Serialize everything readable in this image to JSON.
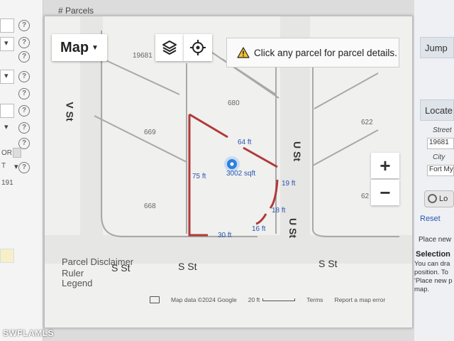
{
  "left_panel": {
    "top_label": "# Parcels",
    "texts": [
      "OR",
      "T",
      "191"
    ]
  },
  "map": {
    "type_button": "Map",
    "notice": "Click any parcel for parcel details.",
    "parcel_numbers": [
      "19681",
      "680",
      "669",
      "668",
      "622",
      "62"
    ],
    "measurements": [
      "64 ft",
      "75 ft",
      "3002 sqft",
      "19 ft",
      "18 ft",
      "16 ft",
      "30 ft"
    ],
    "streets": {
      "v": "V St",
      "u_upper": "U St",
      "u_lower": "U St",
      "s_left": "S St",
      "s_mid": "S St",
      "s_right": "S St"
    },
    "zoom_in": "+",
    "zoom_out": "−",
    "footer_links": [
      "Parcel Disclaimer",
      "Ruler",
      "Legend"
    ],
    "attribution": {
      "data": "Map data ©2024 Google",
      "scale": "20 ft",
      "terms": "Terms",
      "report": "Report a map error"
    },
    "colors": {
      "parcel_outline": "#b03a3a",
      "marker": "#2f7fd8"
    }
  },
  "right_panel": {
    "jump": "Jump",
    "locate": "Locate",
    "street_label": "Street",
    "street_value": "19681",
    "city_label": "City",
    "city_value": "Fort My",
    "locate_button": "Lo",
    "reset": "Reset",
    "place_new": "Place new",
    "selection_title": "Selection",
    "selection_text": [
      "You can dra",
      "position. To",
      "'Place new p",
      "map."
    ]
  },
  "watermark": "SWFLAMLS"
}
